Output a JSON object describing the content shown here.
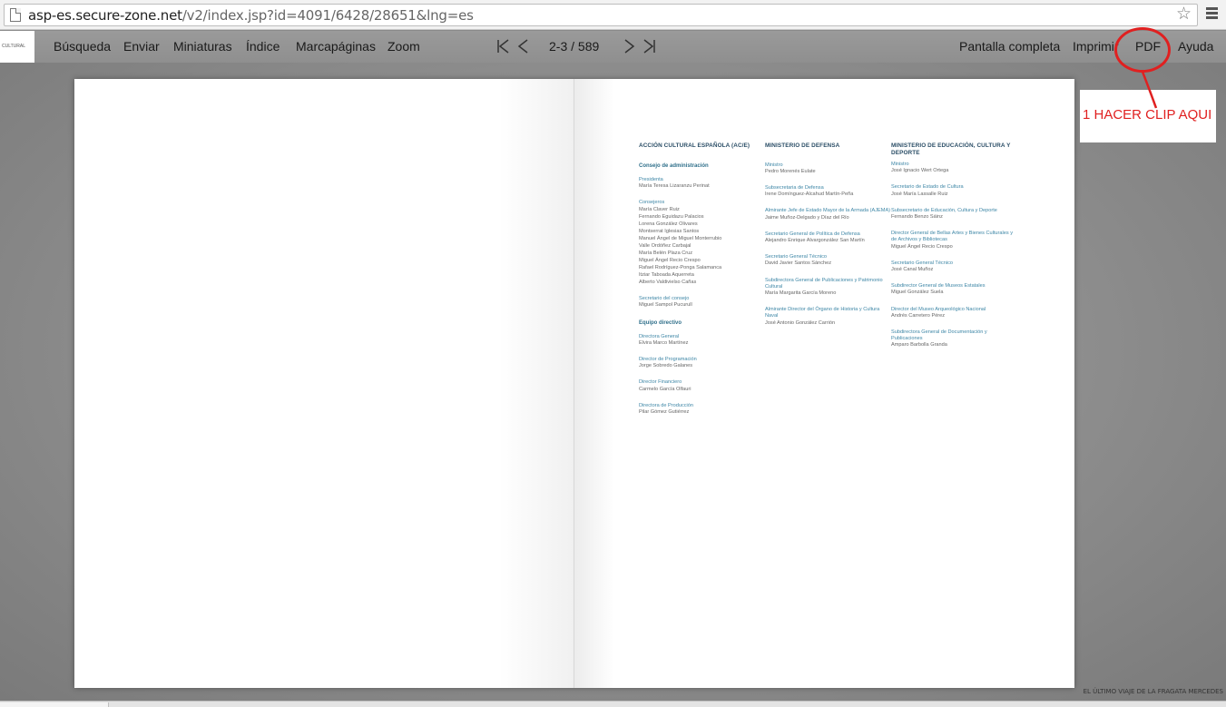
{
  "browser": {
    "url_host": "asp-es.secure-zone.net",
    "url_path": "/v2/index.jsp?id=4091/6428/28651&lng=es"
  },
  "toolbar": {
    "logo_text": "CULTURAL",
    "left_items": [
      "Búsqueda",
      "Enviar",
      "Miniaturas",
      "Índice",
      "Marcapáginas",
      "Zoom"
    ],
    "page_indicator": "2-3 / 589",
    "right_items": [
      "Pantalla completa",
      "Imprimir",
      "PDF",
      "Ayuda"
    ]
  },
  "annotation": {
    "text": "1 HACER CLIP AQUI",
    "color": "#e02020"
  },
  "book": {
    "columns": [
      {
        "heading": "ACCIÓN CULTURAL ESPAÑOLA (AC/E)",
        "sub1": "Consejo de administración",
        "e1_role": "Presidenta",
        "e1_name": "María Teresa Lizaranzu Perinat",
        "e2_role": "Consejeros",
        "e2_names": [
          "María Claver Ruiz",
          "Fernando Eguidazu Palacios",
          "Lorena González Olivares",
          "Montserrat Iglesias Santos",
          "Manuel Ángel de Miguel Monterrubio",
          "Valle Ordóñez Carbajal",
          "María Belén Plaza Cruz",
          "Miguel Ángel Recio Crespo",
          "Rafael Rodríguez-Ponga Salamanca",
          "Itziar Taboada Aquerreta",
          "Alberto Valdivielso Cañas"
        ],
        "e3_role": "Secretario del consejo",
        "e3_name": "Miguel Sampol Pucurull",
        "sub2": "Equipo directivo",
        "e4_role": "Directora General",
        "e4_name": "Elvira Marco Martínez",
        "e5_role": "Director de Programación",
        "e5_name": "Jorge Sobredo Galanes",
        "e6_role": "Director Financiero",
        "e6_name": "Carmelo García Olfauri",
        "e7_role": "Directora de Producción",
        "e7_name": "Pilar Gómez Gutiérrez"
      },
      {
        "heading": "MINISTERIO DE DEFENSA",
        "entries": [
          {
            "role": "Ministro",
            "name": "Pedro Morenés Eulate"
          },
          {
            "role": "Subsecretaria de Defensa",
            "name": "Irene Domínguez-Alcahud Martín-Peña"
          },
          {
            "role": "Almirante Jefe de Estado Mayor de la Armada (AJEMA)",
            "name": "Jaime Muñoz-Delgado y Díaz del Río"
          },
          {
            "role": "Secretario General de Política de Defensa",
            "name": "Alejandro Enrique Alvargonzález San Martín"
          },
          {
            "role": "Secretario General Técnico",
            "name": "David Javier Santos Sánchez"
          },
          {
            "role": "Subdirectora General de Publicaciones y Patrimonio Cultural",
            "name": "María Margarita García Moreno"
          },
          {
            "role": "Almirante Director del Órgano de Historia y Cultura Naval",
            "name": "José Antonio González Carrión"
          }
        ]
      },
      {
        "heading": "MINISTERIO DE EDUCACIÓN, CULTURA Y DEPORTE",
        "entries": [
          {
            "role": "Ministro",
            "name": "José Ignacio Wert Ortega"
          },
          {
            "role": "Secretario de Estado de Cultura",
            "name": "José María Lassalle Ruiz"
          },
          {
            "role": "Subsecretario de Educación, Cultura y Deporte",
            "name": "Fernando Benzo Sáinz"
          },
          {
            "role": "Director General de Bellas Artes y Bienes Culturales y de Archivos y Bibliotecas",
            "name": "Miguel Ángel Recio Crespo"
          },
          {
            "role": "Secretario General Técnico",
            "name": "José Canal Muñoz"
          },
          {
            "role": "Subdirector General de Museos Estatales",
            "name": "Miguel González Suela"
          },
          {
            "role": "Director del Museo Arqueológico Nacional",
            "name": "Andrés Carretero Pérez"
          },
          {
            "role": "Subdirectora General de Documentación y Publicaciones",
            "name": "Amparo Barbolla Granda"
          }
        ]
      }
    ]
  },
  "footer_caption": "EL ÚLTIMO VIAJE DE LA FRAGATA MERCEDES"
}
